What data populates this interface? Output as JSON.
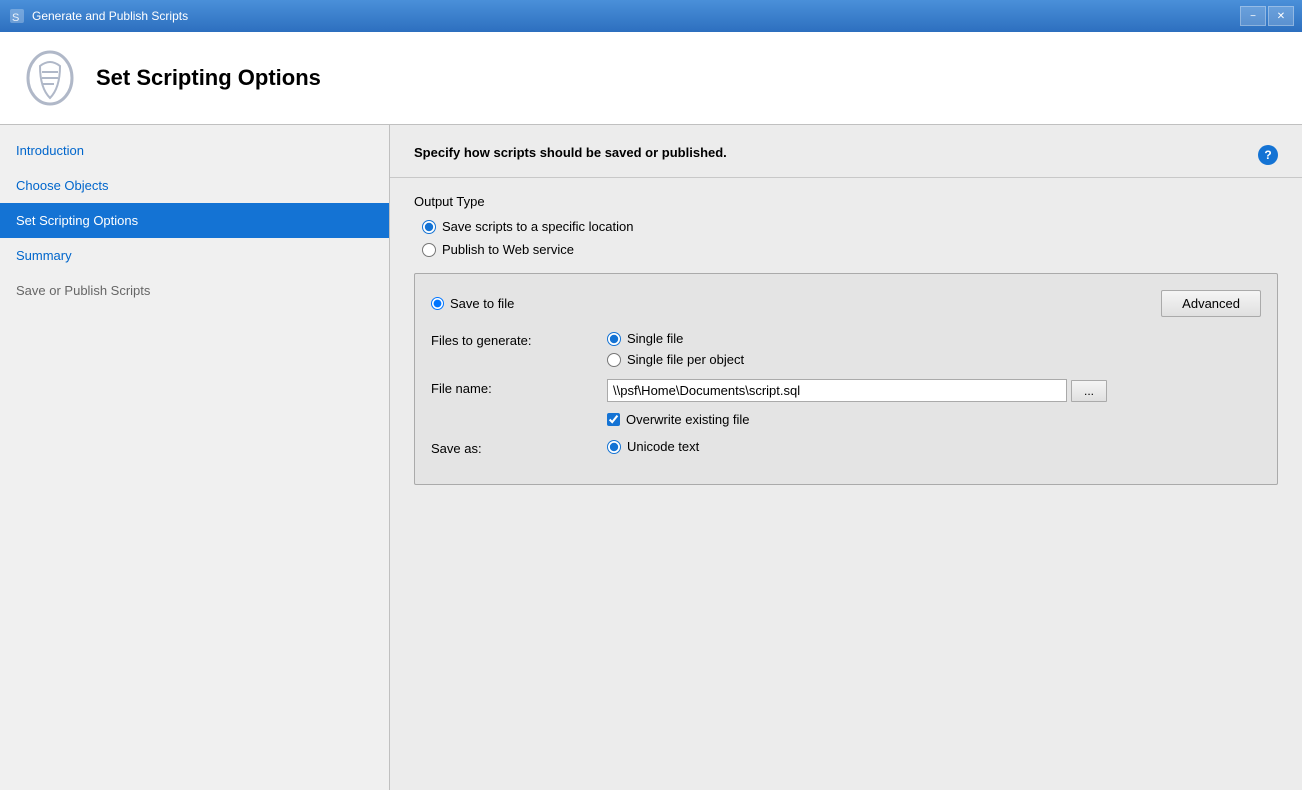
{
  "titleBar": {
    "title": "Generate and Publish Scripts",
    "minimizeLabel": "−",
    "closeLabel": "✕"
  },
  "header": {
    "title": "Set Scripting Options",
    "iconAlt": "Scripting icon"
  },
  "sidebar": {
    "items": [
      {
        "id": "introduction",
        "label": "Introduction",
        "state": "link"
      },
      {
        "id": "choose-objects",
        "label": "Choose Objects",
        "state": "link"
      },
      {
        "id": "set-scripting-options",
        "label": "Set Scripting Options",
        "state": "active"
      },
      {
        "id": "summary",
        "label": "Summary",
        "state": "link"
      },
      {
        "id": "save-or-publish",
        "label": "Save or Publish Scripts",
        "state": "disabled"
      }
    ]
  },
  "content": {
    "description": "Specify how scripts should be saved or published.",
    "helpIconLabel": "?",
    "outputTypeLabel": "Output Type",
    "outputOptions": [
      {
        "id": "save-to-location",
        "label": "Save scripts to a specific location",
        "checked": true
      },
      {
        "id": "publish-web",
        "label": "Publish to Web service",
        "checked": false
      }
    ],
    "saveToFileLabel": "Save to file",
    "advancedButtonLabel": "Advanced",
    "filesToGenerateLabel": "Files to generate:",
    "fileOptions": [
      {
        "id": "single-file",
        "label": "Single file",
        "checked": true
      },
      {
        "id": "single-file-per-object",
        "label": "Single file per object",
        "checked": false
      }
    ],
    "fileNameLabel": "File name:",
    "fileNameValue": "\\\\psf\\Home\\Documents\\script.sql",
    "browseButtonLabel": "...",
    "overwriteLabel": "Overwrite existing file",
    "overwriteChecked": true,
    "saveAsLabel": "Save as:",
    "saveAsOptions": [
      {
        "id": "unicode-text",
        "label": "Unicode text",
        "checked": true
      }
    ]
  }
}
